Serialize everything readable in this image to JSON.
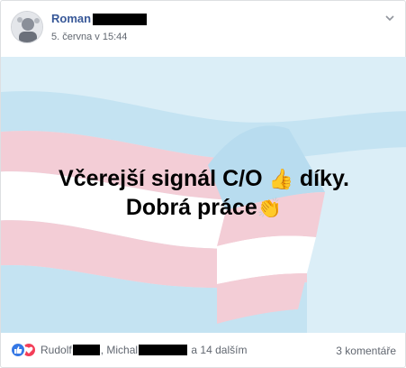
{
  "post": {
    "author_name": "Roman",
    "timestamp": "5. června v 15:44",
    "menu_icon": "chevron-down-icon"
  },
  "image": {
    "line1": "Včerejší signál C/O",
    "emoji1": "👍",
    "line1_end": "díky.",
    "line2": "Dobrá práce",
    "emoji2": "👏",
    "flag_colors": {
      "blue": "#b8dcef",
      "pink": "#f3cdd6",
      "white": "#ffffff",
      "background": "#dbeef7"
    }
  },
  "footer": {
    "reaction_icons": [
      "like-icon",
      "love-icon"
    ],
    "liker1": "Rudolf",
    "sep": ",",
    "liker2": "Michal",
    "others": "a 14 dalším",
    "comments": "3 komentáře"
  },
  "colors": {
    "link": "#385898",
    "meta": "#616770",
    "like": "#3578e5",
    "love": "#f33e58"
  }
}
